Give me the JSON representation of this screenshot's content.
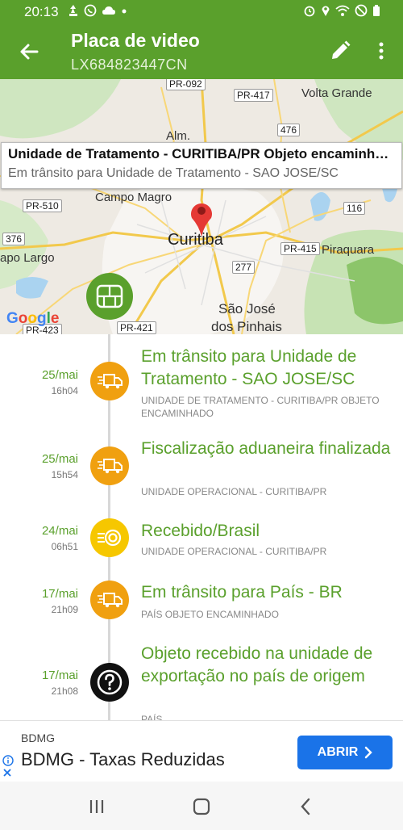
{
  "statusbar": {
    "time": "20:13"
  },
  "appbar": {
    "title": "Placa de video",
    "subtitle": "LX684823447CN"
  },
  "map": {
    "info_title": "Unidade de Tratamento - CURITIBA/PR Objeto encaminhado",
    "info_sub": "Em trânsito para Unidade de Tratamento - SAO JOSE/SC",
    "labels": {
      "pr092": "PR-092",
      "pr417": "PR-417",
      "volta": "Volta Grande",
      "alm": "Alm.",
      "r476": "476",
      "campo": "Campo Magro",
      "pr510": "PR-510",
      "r116": "116",
      "r376": "376",
      "curitiba": "Curitiba",
      "pr415": "PR-415",
      "piraquara": "Piraquara",
      "largo": "apo Largo",
      "r277": "277",
      "sjose1": "São José",
      "sjose2": "dos Pinhais",
      "pr423": "PR-423",
      "pr421": "PR-421"
    },
    "google": "Google"
  },
  "events": [
    {
      "date": "25/mai",
      "time": "16h04",
      "title": "Em trânsito para Unidade de Tratamento - SAO JOSE/SC",
      "sub": "UNIDADE DE TRATAMENTO - CURITIBA/PR OBJETO ENCAMINHADO",
      "icon": "truck-icon"
    },
    {
      "date": "25/mai",
      "time": "15h54",
      "title": "Fiscalização aduaneira finalizada",
      "sub": "UNIDADE OPERACIONAL - CURITIBA/PR",
      "icon": "truck-icon"
    },
    {
      "date": "24/mai",
      "time": "06h51",
      "title": "Recebido/Brasil",
      "sub": "UNIDADE OPERACIONAL - CURITIBA/PR",
      "icon": "received-icon"
    },
    {
      "date": "17/mai",
      "time": "21h09",
      "title": "Em trânsito para País - BR",
      "sub": "PAÍS OBJETO ENCAMINHADO",
      "icon": "truck-icon"
    },
    {
      "date": "17/mai",
      "time": "21h08",
      "title": "Objeto recebido na unidade de exportação no país de origem",
      "sub": "PAÍS",
      "icon": "question-icon"
    }
  ],
  "ad": {
    "brand": "BDMG",
    "title": "BDMG - Taxas Reduzidas",
    "button": "ABRIR"
  },
  "colors": {
    "brand_green": "#5aa02c",
    "event_orange": "#f0a010",
    "event_yellow": "#f6c700",
    "ad_blue": "#1a73e8"
  }
}
